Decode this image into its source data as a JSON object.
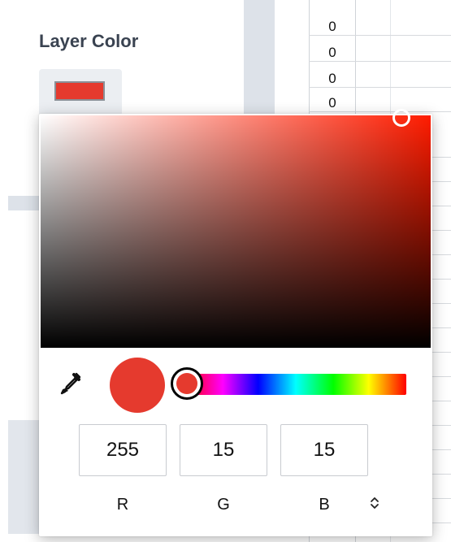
{
  "panel": {
    "title": "Layer Color",
    "swatch_color": "#e53a2e"
  },
  "sheet": {
    "cells": [
      "0",
      "0",
      "0",
      "0"
    ]
  },
  "picker": {
    "current_color": "#e53a2e",
    "base_hue": "#ff1c00",
    "rgb": {
      "r": "255",
      "g": "15",
      "b": "15"
    },
    "labels": {
      "r": "R",
      "g": "G",
      "b": "B"
    },
    "mode_toggle_icon": "up-down-chevron-icon",
    "mode_toggle_glyph": "⌃⌄",
    "eyedropper_icon": "eyedropper-icon"
  }
}
